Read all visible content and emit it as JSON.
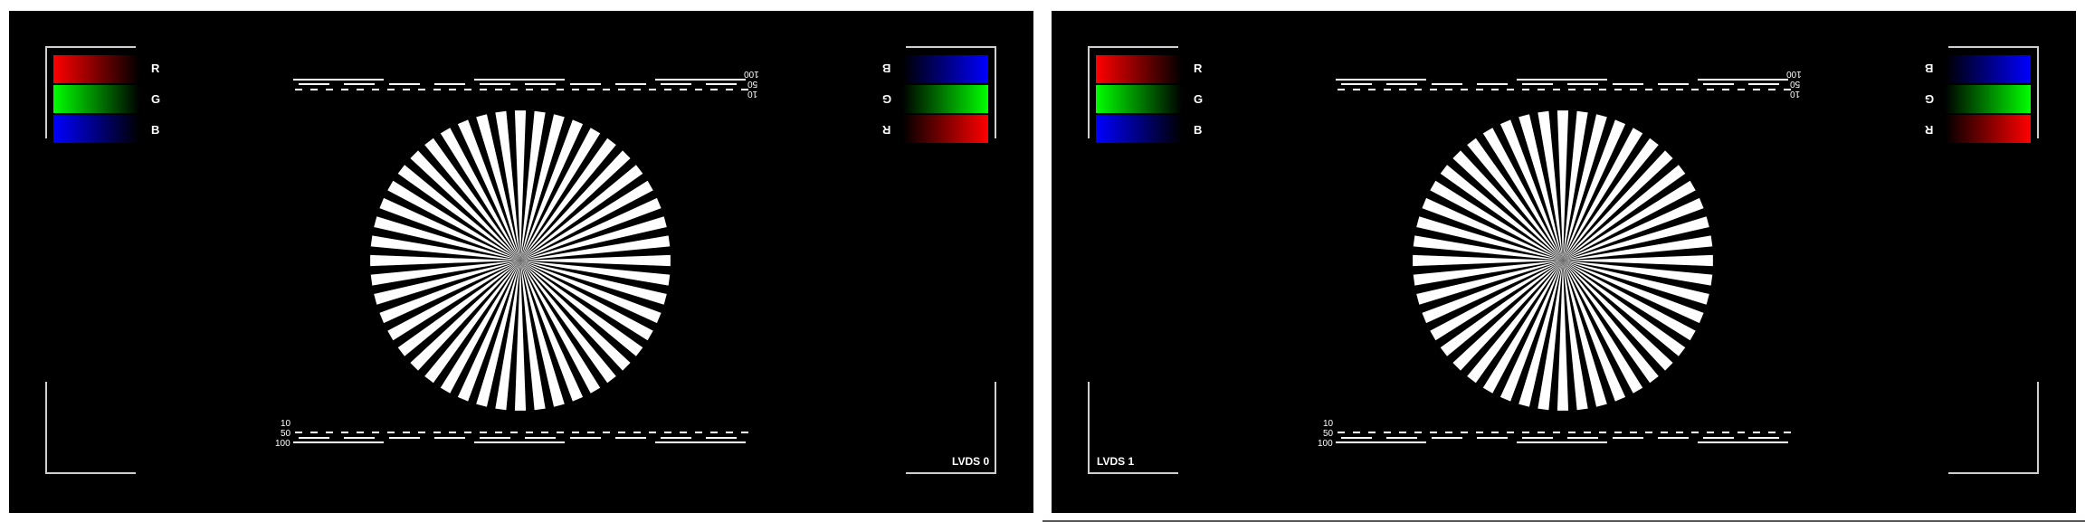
{
  "screens": [
    {
      "caption": "LVDS 0",
      "caption_side": "right",
      "left_labels": [
        "R",
        "G",
        "B"
      ],
      "right_labels": [
        "B",
        "G",
        "R"
      ],
      "scale_labels": [
        "10",
        "50",
        "100"
      ]
    },
    {
      "caption": "LVDS 1",
      "caption_side": "left",
      "left_labels": [
        "R",
        "G",
        "B"
      ],
      "right_labels": [
        "B",
        "G",
        "R"
      ],
      "scale_labels": [
        "10",
        "50",
        "100"
      ]
    }
  ],
  "test_pattern": {
    "star_spokes": 48,
    "swatch_colors": {
      "red": "#ff0000",
      "green": "#00ff00",
      "blue": "#0000ff"
    },
    "background": "#000000",
    "foreground": "#ffffff"
  }
}
